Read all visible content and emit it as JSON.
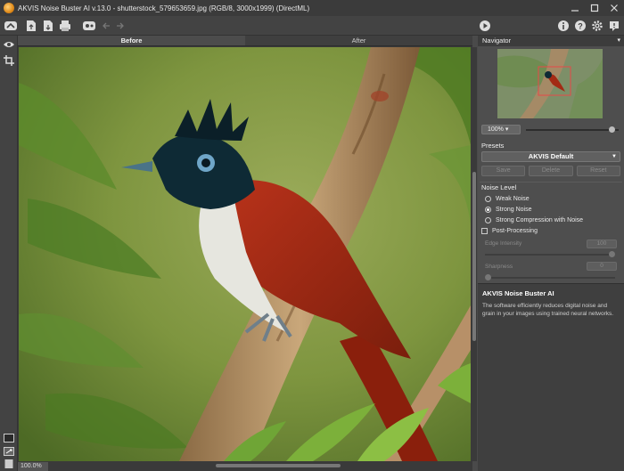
{
  "window": {
    "title": "AKVIS Noise Buster AI v.13.0 - shutterstock_579653659.jpg (RGB/8, 3000x1999) (DirectML)",
    "controls": [
      "minimize",
      "maximize",
      "close"
    ]
  },
  "toolbar": {
    "left_icons": [
      "home-icon",
      "open-file-icon",
      "save-file-icon",
      "print-icon",
      "share-icon",
      "undo-icon",
      "redo-icon"
    ],
    "right_icons": [
      "run-icon",
      "info-icon",
      "help-icon",
      "settings-icon",
      "notifications-icon"
    ]
  },
  "canvas": {
    "tab_before": "Before",
    "tab_after": "After",
    "zoom_display": "100.0%",
    "image_description_icon": "photo-canvas"
  },
  "navigator": {
    "title": "Navigator",
    "zoom": "100%",
    "zoom_level": 0.96
  },
  "presets": {
    "title": "Presets",
    "selected": "AKVIS Default",
    "save": "Save",
    "delete": "Delete",
    "reset": "Reset"
  },
  "noise_level": {
    "title": "Noise Level",
    "options": [
      {
        "label": "Weak Noise",
        "selected": false
      },
      {
        "label": "Strong Noise",
        "selected": true
      },
      {
        "label": "Strong Compression with Noise",
        "selected": false
      }
    ]
  },
  "post_processing": {
    "label": "Post-Processing",
    "checked": false,
    "edge_intensity_label": "Edge Intensity",
    "edge_intensity_value": "100",
    "edge_intensity_fraction": 1.0,
    "sharpness_label": "Sharpness",
    "sharpness_value": "0",
    "sharpness_fraction": 0.0
  },
  "help": {
    "title": "AKVIS Noise Buster AI",
    "text": "The software efficiently reduces digital noise and grain in your images using trained neural networks."
  },
  "colors": {
    "panel": "#4e4e4e",
    "dark": "#3b3b3b",
    "bird_red": "#a32a14",
    "bird_head": "#0e2a35"
  }
}
